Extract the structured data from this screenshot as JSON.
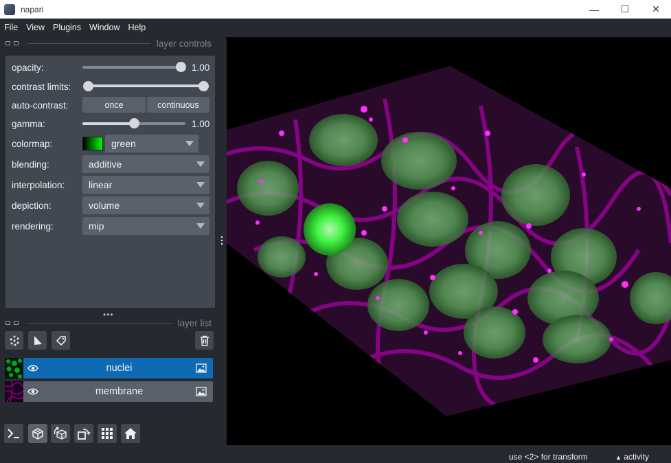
{
  "window": {
    "title": "napari",
    "minimize": "—",
    "maximize": "☐",
    "close": "✕"
  },
  "menu": [
    "File",
    "View",
    "Plugins",
    "Window",
    "Help"
  ],
  "layer_controls": {
    "header": "layer controls",
    "opacity": {
      "label": "opacity:",
      "value": 1.0,
      "display": "1.00"
    },
    "contrast_limits": {
      "label": "contrast limits:",
      "low": 0.0,
      "high": 1.0
    },
    "auto_contrast": {
      "label": "auto-contrast:",
      "once": "once",
      "continuous": "continuous"
    },
    "gamma": {
      "label": "gamma:",
      "value": 0.5,
      "display": "1.00"
    },
    "colormap": {
      "label": "colormap:",
      "value": "green",
      "swatch_color": "#00ff00"
    },
    "blending": {
      "label": "blending:",
      "value": "additive"
    },
    "interpolation": {
      "label": "interpolation:",
      "value": "linear"
    },
    "depiction": {
      "label": "depiction:",
      "value": "volume"
    },
    "rendering": {
      "label": "rendering:",
      "value": "mip"
    }
  },
  "layer_list": {
    "header": "layer list",
    "tools": [
      "points-icon",
      "shapes-icon",
      "labels-icon"
    ],
    "delete_icon": "trash-icon",
    "layers": [
      {
        "name": "nuclei",
        "selected": true,
        "visible": true,
        "color": "#00c832"
      },
      {
        "name": "membrane",
        "selected": false,
        "visible": true,
        "color": "#b400b4"
      }
    ]
  },
  "bottom_toolbar": [
    "console-icon",
    "ndisplay-3d-icon",
    "roll-icon",
    "transpose-icon",
    "grid-icon",
    "home-icon"
  ],
  "status": {
    "left": "use <2> for transform",
    "right": "activity"
  },
  "colors": {
    "accent": "#0f6ab4",
    "panel": "#414851",
    "background": "#262930",
    "green": "#00ff00",
    "magenta": "#ff00ff"
  }
}
